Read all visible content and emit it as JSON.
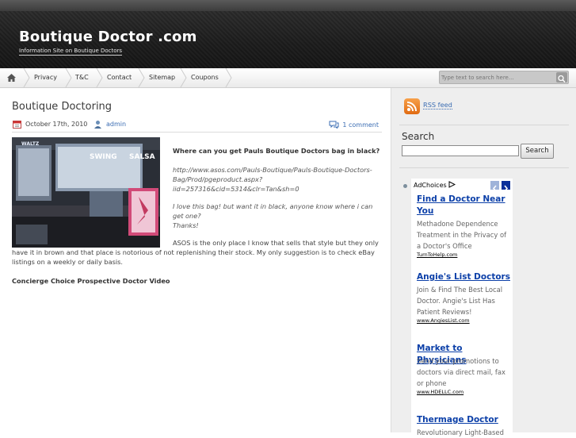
{
  "header": {
    "title": "Boutique Doctor .com",
    "tagline": "Information Site on Boutique Doctors"
  },
  "nav": {
    "items": [
      {
        "label": "Privacy"
      },
      {
        "label": "T&C"
      },
      {
        "label": "Contact"
      },
      {
        "label": "Sitemap"
      },
      {
        "label": "Coupons"
      }
    ],
    "search_placeholder": "Type text to search here..."
  },
  "post": {
    "title": "Boutique Doctoring",
    "date": "October 17th, 2010",
    "author": "admin",
    "comments": "1 comment",
    "question": "Where can you get Pauls Boutique Doctors bag in black?",
    "link": "http://www.asos.com/Pauls-Boutique/Pauls-Boutique-Doctors-Bag/Prod/pgeproduct.aspx?iid=257316&cid=5314&clr=Tan&sh=0",
    "love_line1": "I love this bag! but want it in black, anyone know where i can get one?",
    "love_line2": "Thanks!",
    "answer": "ASOS is the only place I know that sells that style but they only have it in brown and that place is notorious of not replenishing their stock. My only suggestion is to check eBay listings on a weekly or daily basis.",
    "video_title": "Concierge Choice Prospective Doctor Video",
    "image_signs": [
      "SWING",
      "SALSA",
      "WALTZ"
    ]
  },
  "sidebar": {
    "rss_label": "RSS feed",
    "search_heading": "Search",
    "search_button": "Search",
    "ad_choices": "AdChoices",
    "ads": [
      {
        "title": "Find a Doctor Near You",
        "desc": "Methadone Dependence Treatment in the Privacy of a Doctor's Office",
        "url": "TurnToHelp.com"
      },
      {
        "title": "Angie's List Doctors",
        "desc": "Join & Find The Best Local Doctor. Angie's List Has Patient Reviews!",
        "url": "www.AngiesList.com"
      },
      {
        "title": "Market to Physicians",
        "desc": "Send your promotions to doctors via direct mail, fax or phone",
        "url": "www.HDELLC.com"
      },
      {
        "title": "Thermage Doctor",
        "desc": "Revolutionary Light-Based",
        "url": ""
      }
    ]
  },
  "colors": {
    "link": "#3b6db3",
    "ad_title": "#0b3fa8",
    "header_bg": "#1b1b1b",
    "rss": "#e06b12"
  }
}
